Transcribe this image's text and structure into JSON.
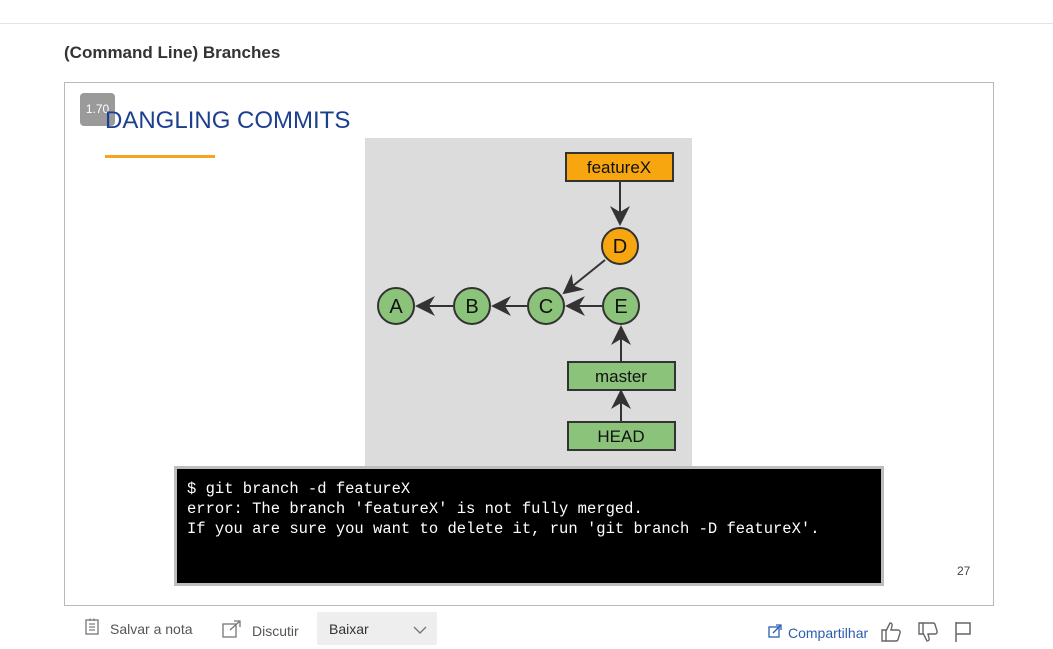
{
  "page": {
    "title": "(Command Line) Branches"
  },
  "slide": {
    "zoom": "1.70",
    "heading": "DANGLING COMMITS",
    "page_number": "27",
    "diagram": {
      "commits": [
        "A",
        "B",
        "C",
        "D",
        "E"
      ],
      "branches": [
        "featureX",
        "master",
        "HEAD"
      ],
      "colors": {
        "branch_fill": "#f7a60f",
        "commit_green": "#8cc37a",
        "commit_orange": "#f7a60f",
        "background": "#dcdcdc"
      }
    },
    "terminal": {
      "lines": [
        "$ git branch -d featureX",
        "error: The branch 'featureX' is not fully merged.",
        "If you are sure you want to delete it, run 'git branch -D featureX'."
      ]
    }
  },
  "footer": {
    "save_label": "Salvar a nota",
    "discuss_label": "Discutir",
    "download_label": "Baixar",
    "share_label": "Compartilhar"
  },
  "icons": {
    "save": "note-icon",
    "discuss": "external-link-icon",
    "share": "share-icon",
    "like": "thumbs-up-icon",
    "dislike": "thumbs-down-icon",
    "flag": "flag-icon"
  }
}
